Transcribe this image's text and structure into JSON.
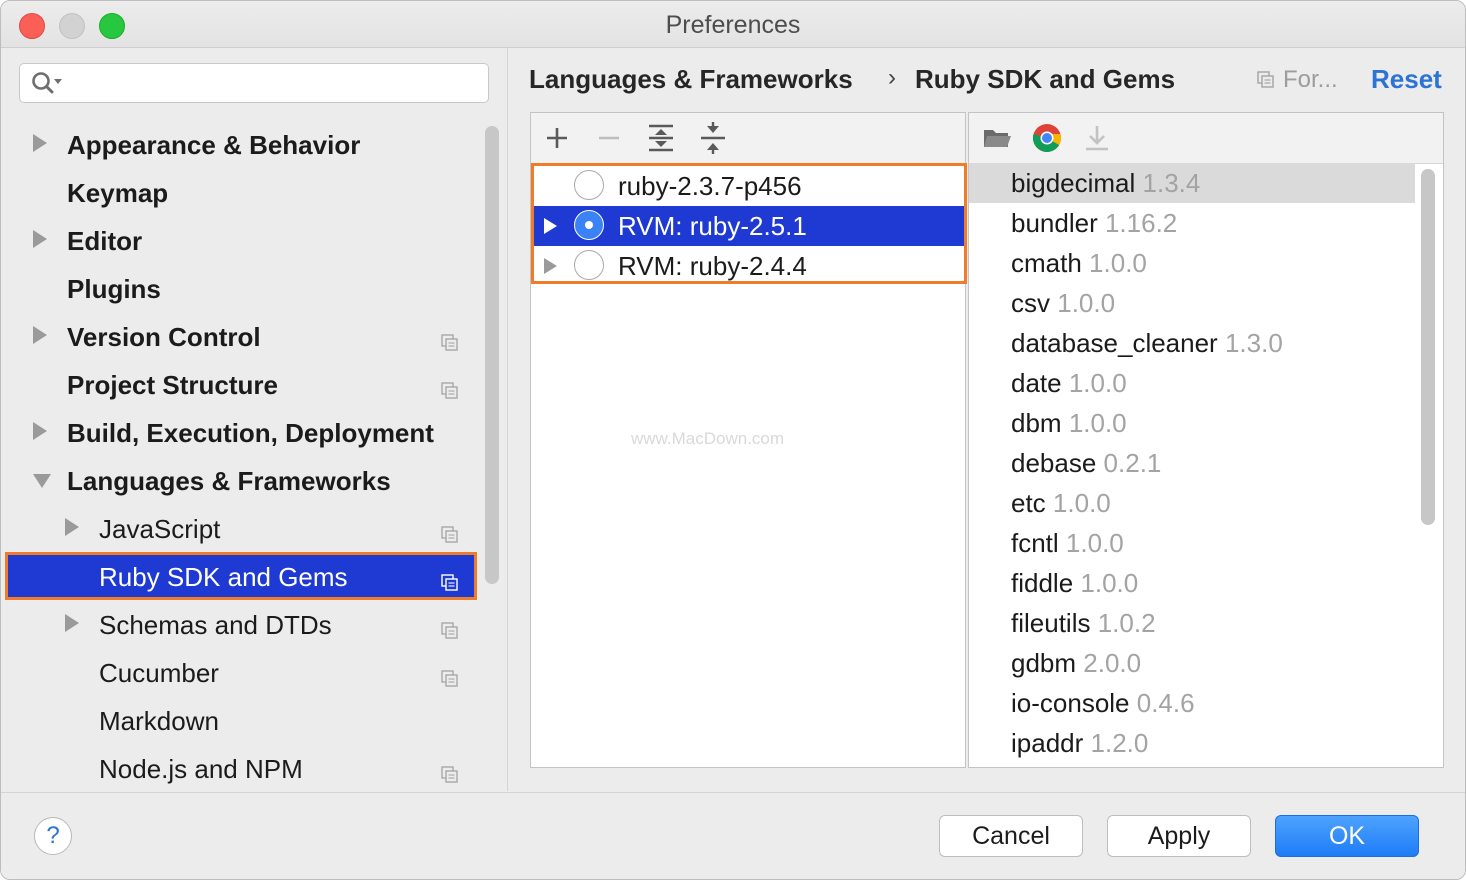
{
  "window": {
    "title": "Preferences"
  },
  "search": {
    "placeholder": "",
    "value": ""
  },
  "sidebar": {
    "items": [
      {
        "label": "Appearance & Behavior",
        "expandable": true
      },
      {
        "label": "Keymap",
        "expandable": false
      },
      {
        "label": "Editor",
        "expandable": true
      },
      {
        "label": "Plugins",
        "expandable": false
      },
      {
        "label": "Version Control",
        "expandable": true,
        "project_icon": true
      },
      {
        "label": "Project Structure",
        "expandable": false,
        "project_icon": true
      },
      {
        "label": "Build, Execution, Deployment",
        "expandable": true
      },
      {
        "label": "Languages & Frameworks",
        "expandable": true,
        "expanded": true
      },
      {
        "label": "JavaScript",
        "expandable": true,
        "project_icon": true
      },
      {
        "label": "Ruby SDK and Gems",
        "selected": true,
        "project_icon": true
      },
      {
        "label": "Schemas and DTDs",
        "expandable": true,
        "project_icon": true
      },
      {
        "label": "Cucumber",
        "project_icon": true
      },
      {
        "label": "Markdown"
      },
      {
        "label": "Node.js and NPM",
        "project_icon": true
      }
    ]
  },
  "header": {
    "breadcrumb_parent": "Languages & Frameworks",
    "breadcrumb_separator": "›",
    "breadcrumb_current": "Ruby SDK and Gems",
    "for_label": "For...",
    "reset_label": "Reset"
  },
  "sdk_toolbar": [
    "add-icon",
    "remove-icon",
    "expand-all-icon",
    "collapse-all-icon"
  ],
  "sdks": [
    {
      "label": "ruby-2.3.7-p456",
      "selected": false,
      "expandable": false
    },
    {
      "label": "RVM: ruby-2.5.1",
      "selected": true,
      "expandable": true
    },
    {
      "label": "RVM: ruby-2.4.4",
      "selected": false,
      "expandable": true
    }
  ],
  "watermark": "www.MacDown.com",
  "gems_toolbar": [
    "folder-icon",
    "chrome-icon",
    "download-icon"
  ],
  "gems": [
    {
      "name": "bigdecimal",
      "version": "1.3.4",
      "selected": true
    },
    {
      "name": "bundler",
      "version": "1.16.2"
    },
    {
      "name": "cmath",
      "version": "1.0.0"
    },
    {
      "name": "csv",
      "version": "1.0.0"
    },
    {
      "name": "database_cleaner",
      "version": "1.3.0"
    },
    {
      "name": "date",
      "version": "1.0.0"
    },
    {
      "name": "dbm",
      "version": "1.0.0"
    },
    {
      "name": "debase",
      "version": "0.2.1"
    },
    {
      "name": "etc",
      "version": "1.0.0"
    },
    {
      "name": "fcntl",
      "version": "1.0.0"
    },
    {
      "name": "fiddle",
      "version": "1.0.0"
    },
    {
      "name": "fileutils",
      "version": "1.0.2"
    },
    {
      "name": "gdbm",
      "version": "2.0.0"
    },
    {
      "name": "io-console",
      "version": "0.4.6"
    },
    {
      "name": "ipaddr",
      "version": "1.2.0"
    }
  ],
  "footer": {
    "help_label": "?",
    "cancel_label": "Cancel",
    "apply_label": "Apply",
    "ok_label": "OK"
  },
  "colors": {
    "selection": "#1f3ad3",
    "highlight_outline": "#f07b28",
    "link": "#2b73d5",
    "primary_button": "#1e7cf6"
  }
}
